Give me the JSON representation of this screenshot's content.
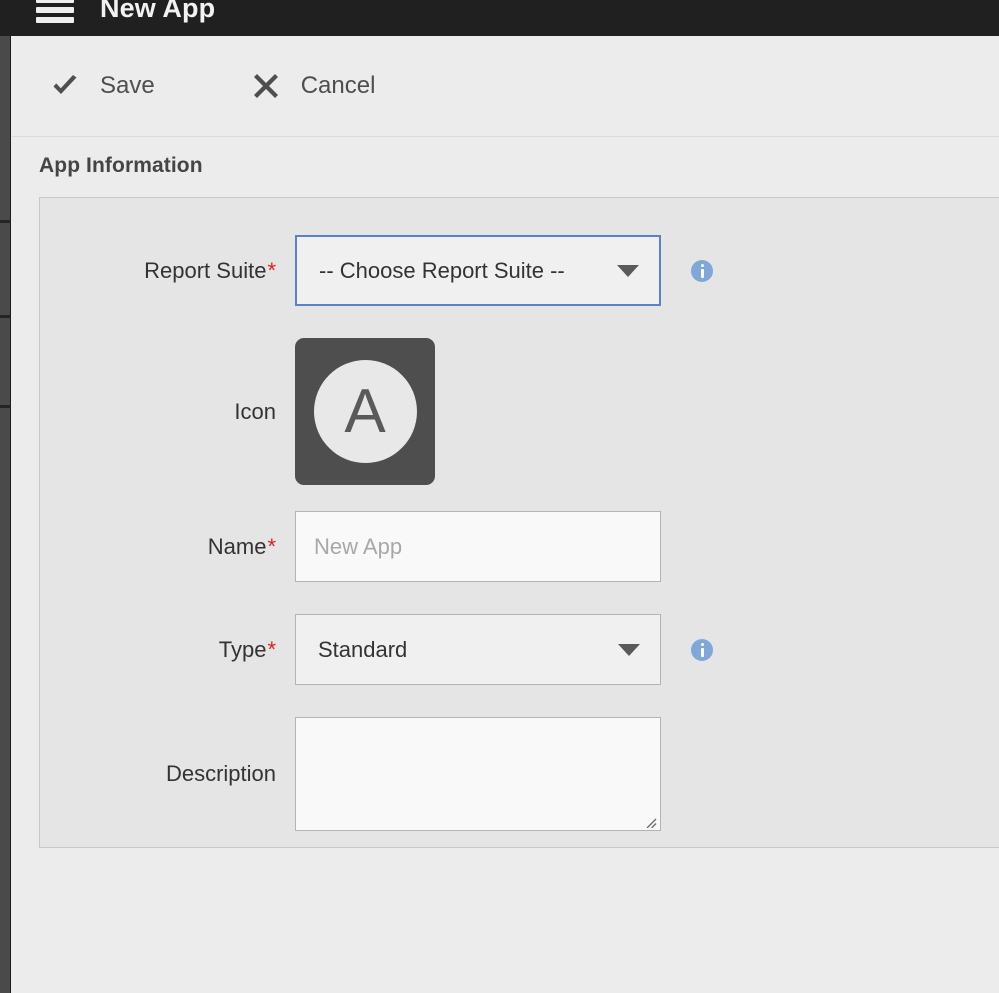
{
  "window": {
    "title": "New App",
    "menu_icon": "hamburger-menu-icon"
  },
  "toolbar": {
    "save_label": "Save",
    "save_icon": "checkmark-icon",
    "cancel_label": "Cancel",
    "cancel_icon": "close-x-icon"
  },
  "section": {
    "title": "App Information"
  },
  "form": {
    "report_suite": {
      "label": "Report Suite",
      "required_marker": "*",
      "value": "-- Choose Report Suite --",
      "info_icon": "info-icon",
      "focused": true
    },
    "icon": {
      "label": "Icon",
      "letter": "A"
    },
    "name": {
      "label": "Name",
      "required_marker": "*",
      "value": "",
      "placeholder": "New App"
    },
    "type": {
      "label": "Type",
      "required_marker": "*",
      "value": "Standard",
      "info_icon": "info-icon"
    },
    "description": {
      "label": "Description",
      "value": "",
      "placeholder": ""
    }
  },
  "colors": {
    "header_bar": "#202020",
    "page_background": "#ececec",
    "panel_background": "#e5e5e5",
    "focus_border": "#5b82c9",
    "required_asterisk": "#e02020",
    "info_icon": "#7fa8d9",
    "icon_tile": "#4e4e4e"
  }
}
